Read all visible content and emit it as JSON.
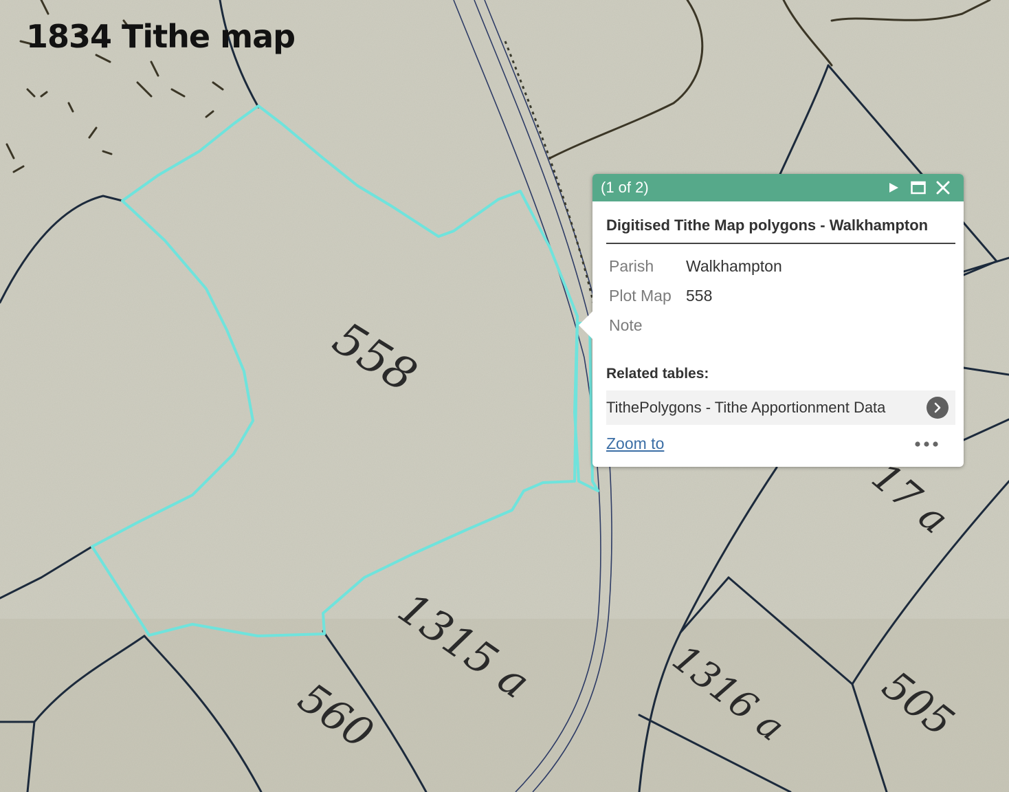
{
  "map": {
    "title": "1834 Tithe map",
    "plot_labels": [
      "558",
      "1315 a",
      "560",
      "1316 a",
      "505",
      "17 a"
    ],
    "highlight_color": "#6fe3dc",
    "line_color": "#1c2a3c"
  },
  "popup": {
    "count": "(1 of 2)",
    "layer_title": "Digitised Tithe Map polygons - Walkhampton",
    "attributes": [
      {
        "name": "Parish",
        "value": "Walkhampton"
      },
      {
        "name": "Plot Map",
        "value": "558"
      },
      {
        "name": "Note",
        "value": ""
      }
    ],
    "related_title": "Related tables:",
    "related_item": "TithePolygons - Tithe Apportionment Data",
    "zoom_label": "Zoom to",
    "header_color": "#56a98a",
    "icons": [
      "play-icon",
      "maximize-icon",
      "close-icon",
      "chevron-right-icon",
      "more-dots-icon"
    ]
  }
}
